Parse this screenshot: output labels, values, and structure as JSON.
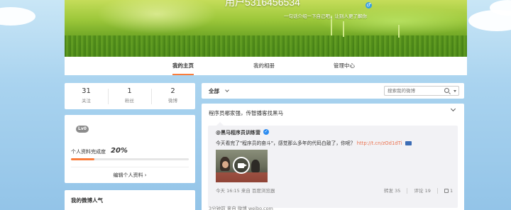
{
  "profile": {
    "username": "用户5316456534",
    "bio": "一句话介绍一下自己吧，让别人更了解你",
    "gender_icon": "male-icon"
  },
  "tabs": [
    {
      "label": "我的主页",
      "active": true
    },
    {
      "label": "我的相册",
      "active": false
    },
    {
      "label": "管理中心",
      "active": false
    }
  ],
  "stats": [
    {
      "value": "31",
      "label": "关注"
    },
    {
      "value": "1",
      "label": "粉丝"
    },
    {
      "value": "2",
      "label": "微博"
    }
  ],
  "level_badge": "Lv0",
  "completion": {
    "label": "个人资料完成度",
    "value": "20%",
    "fraction": 0.2
  },
  "edit_profile": "编辑个人资料 ›",
  "popular_title": "我的微博人气",
  "filter": {
    "all_label": "全部",
    "search_placeholder": "搜索我的微博"
  },
  "post": {
    "text": "程序员哪家强，传智播客找黑马",
    "repost": {
      "source": "@黑马程序员训练营",
      "body": "今天看完了\"程序员的奋斗\"，感觉那么多年的代码白敲了，你呢？",
      "link": "http://t.cn/zOd1dTi",
      "time": "今天 16:15 来自 百度浏览器",
      "forward": "转发 35",
      "comment": "评论 19",
      "like": "1"
    },
    "footer": "3分钟前 来自 微博 weibo.com"
  },
  "colors": {
    "accent": "#fa7d3c",
    "link": "#eb7350",
    "verified": "#2d8cf0"
  }
}
